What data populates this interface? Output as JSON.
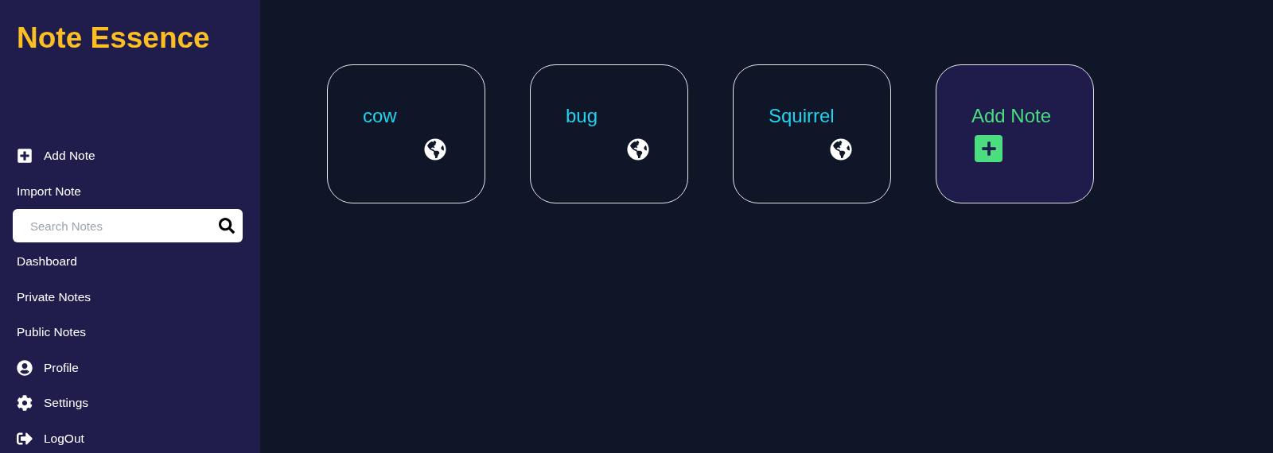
{
  "sidebar": {
    "title": "Note Essence",
    "items": [
      {
        "kind": "add",
        "label": "Add Note"
      },
      {
        "kind": "plain",
        "label": "Import Note"
      },
      {
        "kind": "search",
        "placeholder": "Search Notes"
      },
      {
        "kind": "plain",
        "label": "Dashboard"
      },
      {
        "kind": "plain",
        "label": "Private Notes"
      },
      {
        "kind": "plain",
        "label": "Public Notes"
      },
      {
        "kind": "profile",
        "label": "Profile"
      },
      {
        "kind": "settings",
        "label": "Settings"
      },
      {
        "kind": "logout",
        "label": "LogOut"
      }
    ]
  },
  "notes": [
    {
      "kind": "note",
      "title": "cow",
      "public": true
    },
    {
      "kind": "note",
      "title": "bug",
      "public": true
    },
    {
      "kind": "note",
      "title": "Squirrel",
      "public": true
    },
    {
      "kind": "add",
      "title": "Add Note"
    }
  ]
}
